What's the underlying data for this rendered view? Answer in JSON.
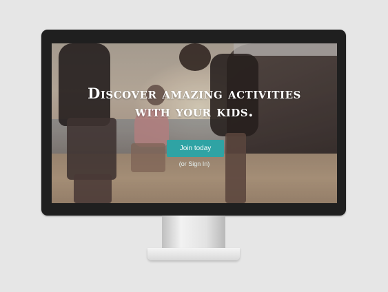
{
  "hero": {
    "headline_line1": "Discover amazing activities",
    "headline_line2": "with your kids.",
    "join_button_label": "Join today",
    "signin_link_label": "(or Sign In)"
  },
  "colors": {
    "page_background": "#e6e6e6",
    "bezel": "#1f1f1f",
    "accent_button": "#2fa3a4",
    "text_light": "#ffffff"
  },
  "icons": {}
}
